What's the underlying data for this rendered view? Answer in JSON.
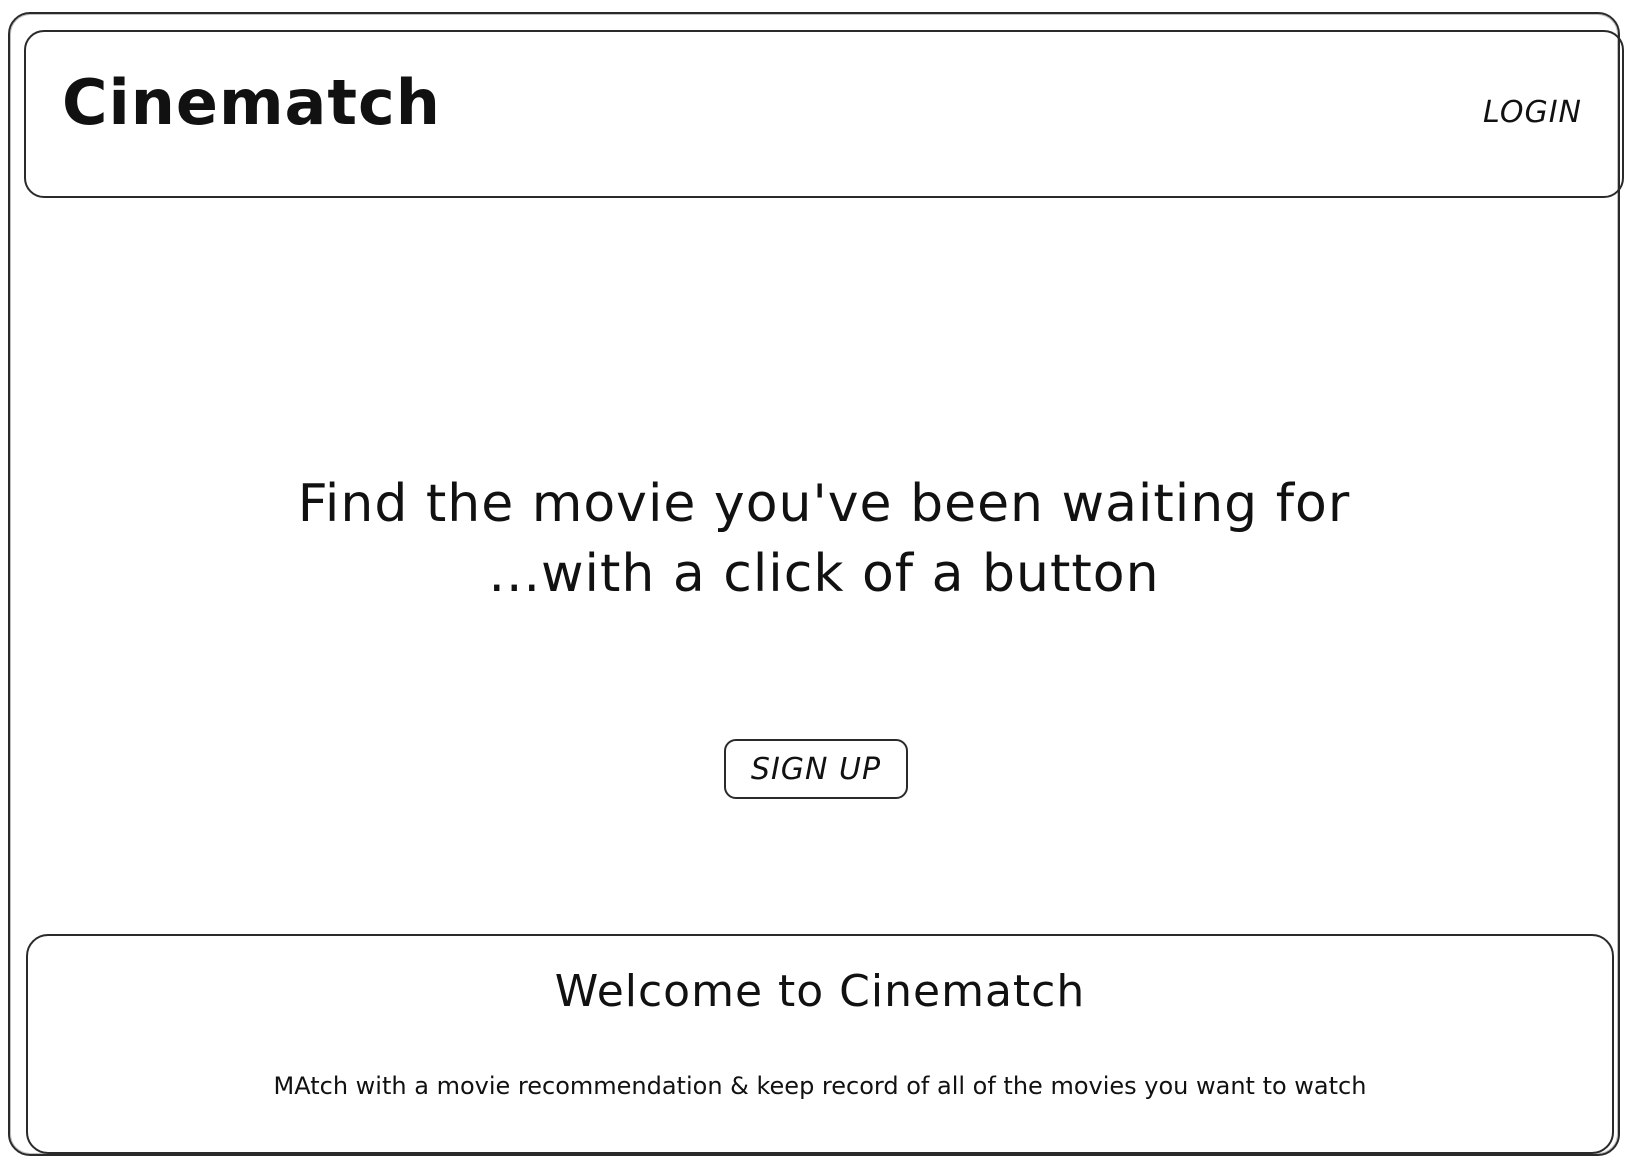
{
  "header": {
    "logo_text": "Cinematch",
    "login_label": "LOGIN"
  },
  "hero": {
    "line1": "Find the movie you've been waiting for",
    "line2": "...with a click of a button",
    "signup_label": "SIGN UP"
  },
  "footer": {
    "title": "Welcome to Cinematch",
    "description": "MAtch with a movie recommendation & keep record of all of the movies you want to watch"
  },
  "colors": {
    "ink": "#111111",
    "background": "#ffffff"
  }
}
